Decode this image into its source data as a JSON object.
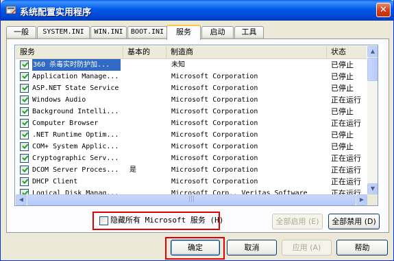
{
  "window": {
    "title": "系统配置实用程序",
    "close_glyph": "✕"
  },
  "tabs": [
    {
      "label": "一般"
    },
    {
      "label": "SYSTEM.INI"
    },
    {
      "label": "WIN.INI"
    },
    {
      "label": "BOOT.INI"
    },
    {
      "label": "服务",
      "active": true
    },
    {
      "label": "启动"
    },
    {
      "label": "工具"
    }
  ],
  "list": {
    "columns": {
      "service": "服务",
      "essential": "基本的",
      "manufacturer": "制造商",
      "status": "状态"
    },
    "rows": [
      {
        "service": "360 杀毒实时防护加...",
        "essential": "",
        "manufacturer": "未知",
        "status": "已停止",
        "checked": true,
        "selected": true
      },
      {
        "service": "Application Manage...",
        "essential": "",
        "manufacturer": "Microsoft Corporation",
        "status": "已停止",
        "checked": true
      },
      {
        "service": "ASP.NET State Service",
        "essential": "",
        "manufacturer": "Microsoft Corporation",
        "status": "已停止",
        "checked": true
      },
      {
        "service": "Windows Audio",
        "essential": "",
        "manufacturer": "Microsoft Corporation",
        "status": "正在运行",
        "checked": true
      },
      {
        "service": "Background Intelli...",
        "essential": "",
        "manufacturer": "Microsoft Corporation",
        "status": "已停止",
        "checked": true
      },
      {
        "service": "Computer Browser",
        "essential": "",
        "manufacturer": "Microsoft Corporation",
        "status": "正在运行",
        "checked": true
      },
      {
        "service": ".NET Runtime Optim...",
        "essential": "",
        "manufacturer": "Microsoft Corporation",
        "status": "已停止",
        "checked": true
      },
      {
        "service": "COM+ System Applic...",
        "essential": "",
        "manufacturer": "Microsoft Corporation",
        "status": "已停止",
        "checked": true
      },
      {
        "service": "Cryptographic Serv...",
        "essential": "",
        "manufacturer": "Microsoft Corporation",
        "status": "正在运行",
        "checked": true
      },
      {
        "service": "DCOM Server Proces...",
        "essential": "是",
        "manufacturer": "Microsoft Corporation",
        "status": "正在运行",
        "checked": true
      },
      {
        "service": "DHCP Client",
        "essential": "",
        "manufacturer": "Microsoft Corporation",
        "status": "正在运行",
        "checked": true
      },
      {
        "service": "Logical Disk Manag...",
        "essential": "",
        "manufacturer": "Microsoft Corp., Veritas Software",
        "status": "正在运行",
        "checked": true
      }
    ]
  },
  "hide_ms": {
    "label": "隐藏所有 Microsoft 服务 (H)",
    "checked": false
  },
  "buttons": {
    "enable_all": "全部启用 (E)",
    "disable_all": "全部禁用 (D)",
    "ok": "确定",
    "cancel": "取消",
    "apply": "应用 (A)",
    "help": "帮助"
  },
  "colors": {
    "selection": "#316ac5",
    "highlight_box": "#e00000",
    "title_bar": "#0058e6"
  }
}
